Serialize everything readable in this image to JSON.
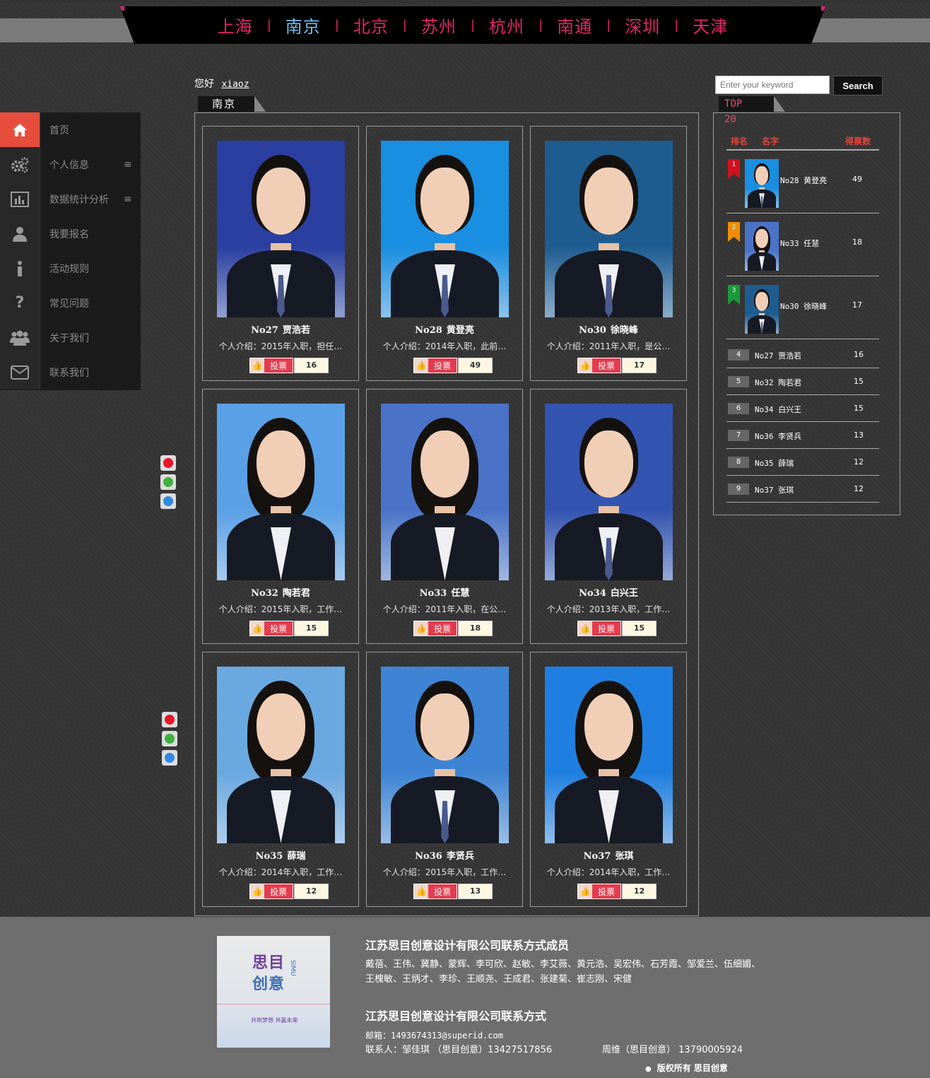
{
  "cities": [
    {
      "label": "上海",
      "active": false
    },
    {
      "label": "南京",
      "active": true
    },
    {
      "label": "北京",
      "active": false
    },
    {
      "label": "苏州",
      "active": false
    },
    {
      "label": "杭州",
      "active": false
    },
    {
      "label": "南通",
      "active": false
    },
    {
      "label": "深圳",
      "active": false
    },
    {
      "label": "天津",
      "active": false
    }
  ],
  "city_separator": "|",
  "greeting": {
    "prefix": "您好",
    "username": "xiaoz"
  },
  "current_city_tab": "南京",
  "search": {
    "placeholder": "Enter your keyword",
    "button": "Search"
  },
  "sidebar": {
    "items": [
      {
        "label": "首页",
        "icon": "home-icon",
        "active": true,
        "submenu": false
      },
      {
        "label": "个人信息",
        "icon": "gears-icon",
        "active": false,
        "submenu": true
      },
      {
        "label": "数据统计分析",
        "icon": "bar-chart-icon",
        "active": false,
        "submenu": true
      },
      {
        "label": "我要报名",
        "icon": "user-icon",
        "active": false,
        "submenu": false
      },
      {
        "label": "活动规则",
        "icon": "info-icon",
        "active": false,
        "submenu": false
      },
      {
        "label": "常见问题",
        "icon": "question-icon",
        "active": false,
        "submenu": false
      },
      {
        "label": "关于我们",
        "icon": "group-icon",
        "active": false,
        "submenu": false
      },
      {
        "label": "联系我们",
        "icon": "envelope-icon",
        "active": false,
        "submenu": false
      }
    ]
  },
  "share_icons": [
    "weibo-icon",
    "wechat-icon",
    "favorite-icon"
  ],
  "vote_label": "投票",
  "candidates": [
    {
      "no": "No27",
      "name": "贾浩若",
      "intro": "个人介绍：2015年入职，担任…",
      "votes": "16",
      "gender": "m",
      "bg": "#2a3fa0"
    },
    {
      "no": "No28",
      "name": "黄登亮",
      "intro": "个人介绍：2014年入职，此前…",
      "votes": "49",
      "gender": "m",
      "bg": "#1a8ee0"
    },
    {
      "no": "No30",
      "name": "徐晓峰",
      "intro": "个人介绍：2011年入职，是公…",
      "votes": "17",
      "gender": "m",
      "bg": "#1e5c90"
    },
    {
      "no": "No32",
      "name": "陶若君",
      "intro": "个人介绍：2015年入职，工作…",
      "votes": "15",
      "gender": "f",
      "bg": "#5aa0e6"
    },
    {
      "no": "No33",
      "name": "任慧",
      "intro": "个人介绍：2011年入职，在公…",
      "votes": "18",
      "gender": "f",
      "bg": "#4a73c8"
    },
    {
      "no": "No34",
      "name": "白兴王",
      "intro": "个人介绍：2013年入职，工作…",
      "votes": "15",
      "gender": "m",
      "bg": "#3354b0"
    },
    {
      "no": "No35",
      "name": "薛瑞",
      "intro": "个人介绍：2014年入职，工作…",
      "votes": "12",
      "gender": "f",
      "bg": "#6aa8e0"
    },
    {
      "no": "No36",
      "name": "李贤兵",
      "intro": "个人介绍：2015年入职，工作…",
      "votes": "13",
      "gender": "m",
      "bg": "#3e84d4"
    },
    {
      "no": "No37",
      "name": "张琪",
      "intro": "个人介绍：2014年入职，工作…",
      "votes": "12",
      "gender": "f",
      "bg": "#1f7fe0"
    }
  ],
  "top20": {
    "tab": "TOP 20",
    "header": {
      "rank": "排名",
      "name": "名字",
      "score": "得票数"
    },
    "podium": [
      {
        "rank": "1",
        "label": "No28 黄登亮",
        "score": "49",
        "color": "#d0121f",
        "bg": "#1a8ee0",
        "gender": "m"
      },
      {
        "rank": "2",
        "label": "No33 任慧",
        "score": "18",
        "color": "#f08c00",
        "bg": "#4a73c8",
        "gender": "f"
      },
      {
        "rank": "3",
        "label": "No30 徐晓峰",
        "score": "17",
        "color": "#1a9a3a",
        "bg": "#1e5c90",
        "gender": "m"
      }
    ],
    "rows": [
      {
        "rank": "4",
        "label": "No27 贾浩若",
        "score": "16"
      },
      {
        "rank": "5",
        "label": "No32 陶若君",
        "score": "15"
      },
      {
        "rank": "6",
        "label": "No34 白兴王",
        "score": "15"
      },
      {
        "rank": "7",
        "label": "No36 李贤兵",
        "score": "13"
      },
      {
        "rank": "8",
        "label": "No35 薛瑞",
        "score": "12"
      },
      {
        "rank": "9",
        "label": "No37 张琪",
        "score": "12"
      }
    ]
  },
  "footer": {
    "logo": {
      "line1": "思目",
      "line2": "创意",
      "side": "SIMU",
      "slogan": "共筑梦想 共赢未来"
    },
    "members_title": "江苏思目创意设计有限公司联系方式成员",
    "members": "戴蓓、王伟、冀静、蒙辉、李可欣、赵敏、李艾薇、黄元浩、吴宏伟、石芳霞、邹爱兰、伍细媚、王槐敏、王炳才、李珍、王顺尧、王成君、张建菊、崔志刚、宋健",
    "contact_title": "江苏思目创意设计有限公司联系方式",
    "email": "邮箱：1493674313@superid.com",
    "contact1": "联系人：邹佳琪 （思目创意）13427517856",
    "contact2": "周维（思目创意） 13790005924",
    "copyright": "版权所有 思目创意"
  }
}
